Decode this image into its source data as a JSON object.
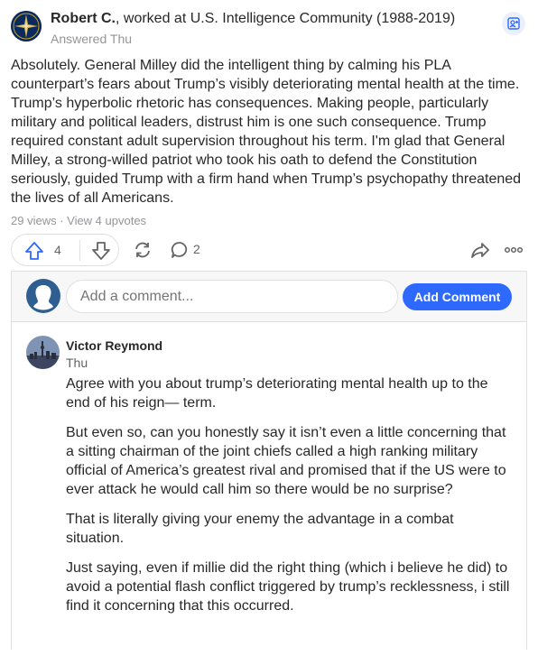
{
  "answer": {
    "author_name": "Robert C.",
    "author_credential": ", worked at U.S. Intelligence Community (1988-2019)",
    "answered": "Answered Thu",
    "body": "Absolutely. General Milley did the intelligent thing by calming his PLA counterpart’s fears about Trump’s visibly deteriorating mental health at the time. Trump’s hyperbolic rhetoric has consequences. Making people, particularly military and political leaders, distrust him is one such consequence. Trump required constant adult supervision throughout his term. I'm glad that General Milley, a strong-willed patriot who took his oath to defend the Constitution seriously, guided Trump with a firm hand when Trump’s psychopathy threatened the lives of all Americans.",
    "stats": "29 views · View 4 upvotes"
  },
  "actions": {
    "upvote_count": "4",
    "comment_count": "2",
    "icons": [
      "upvote-icon",
      "downvote-icon",
      "reshare-icon",
      "comment-icon",
      "share-icon",
      "more-icon"
    ]
  },
  "composer": {
    "placeholder": "Add a comment...",
    "button_label": "Add Comment"
  },
  "comment": {
    "author": "Victor Reymond",
    "time": "Thu",
    "paragraphs": [
      "Agree with you about trump’s deteriorating mental health up to the end of his reign— term.",
      "But even so, can you honestly say it isn’t even a little concerning that a sitting chairman of the joint chiefs called a high ranking military official of America’s greatest rival and promised that if the US were to ever attack he would call him so there would be no surprise?",
      "That is literally giving your enemy the advantage in a combat situation.",
      "Just saying, even if millie did the right thing (which i believe he did) to avoid a potential flash conflict triggered by trump’s recklessness, i still find it concerning that this occurred."
    ]
  },
  "colors": {
    "accent": "#2e69ff",
    "text": "#282829",
    "muted": "#939598",
    "border": "#dee0e1"
  }
}
